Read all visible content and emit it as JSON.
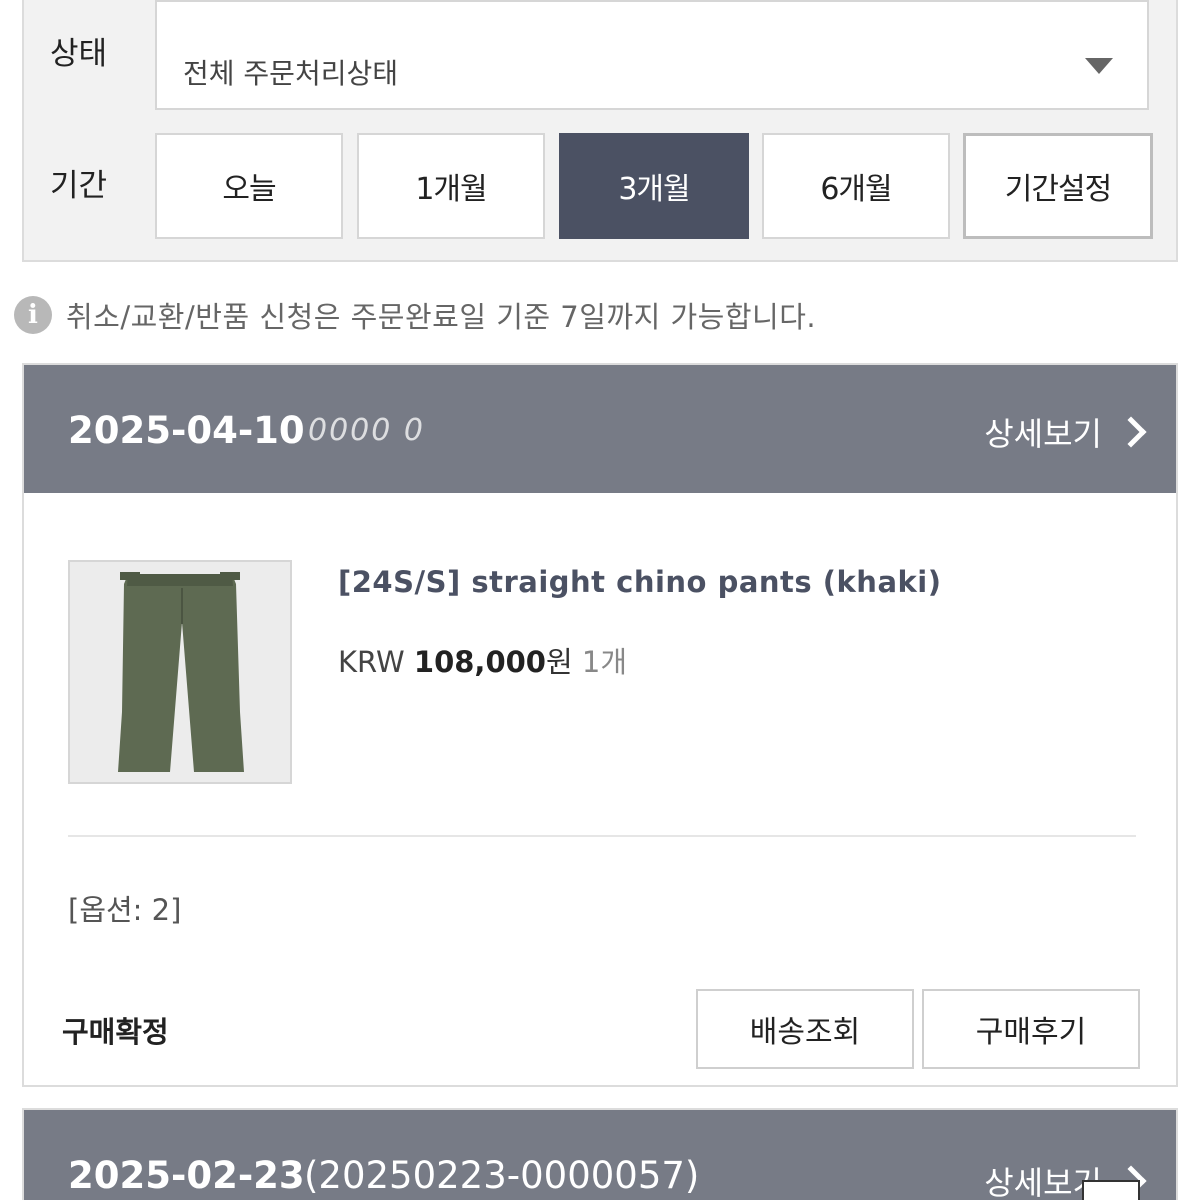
{
  "filters": {
    "status_label": "상태",
    "status_value": "전체 주문처리상태",
    "period_label": "기간",
    "periods": [
      {
        "label": "오늘",
        "active": false
      },
      {
        "label": "1개월",
        "active": false
      },
      {
        "label": "3개월",
        "active": true
      },
      {
        "label": "6개월",
        "active": false
      },
      {
        "label": "기간설정",
        "active": false
      }
    ]
  },
  "notice": {
    "icon": "info-icon",
    "text": "취소/교환/반품 신청은 주문완료일 기준 7일까지 가능합니다."
  },
  "orders": [
    {
      "date": "2025-04-10",
      "number": "0000 0",
      "detail_label": "상세보기",
      "product": {
        "name": "[24S/S] straight chino pants (khaki)",
        "currency": "KRW",
        "price": "108,000",
        "price_unit": "원",
        "quantity": "1개",
        "option": "[옵션: 2]"
      },
      "status": "구매확정",
      "actions": [
        "배송조회",
        "구매후기"
      ]
    },
    {
      "date": "2025-02-23",
      "number": "(20250223-0000057)",
      "detail_label": "상세보기"
    }
  ],
  "colors": {
    "active_tab": "#4b5163",
    "order_header": "#777b86",
    "product_name": "#4b5163"
  }
}
